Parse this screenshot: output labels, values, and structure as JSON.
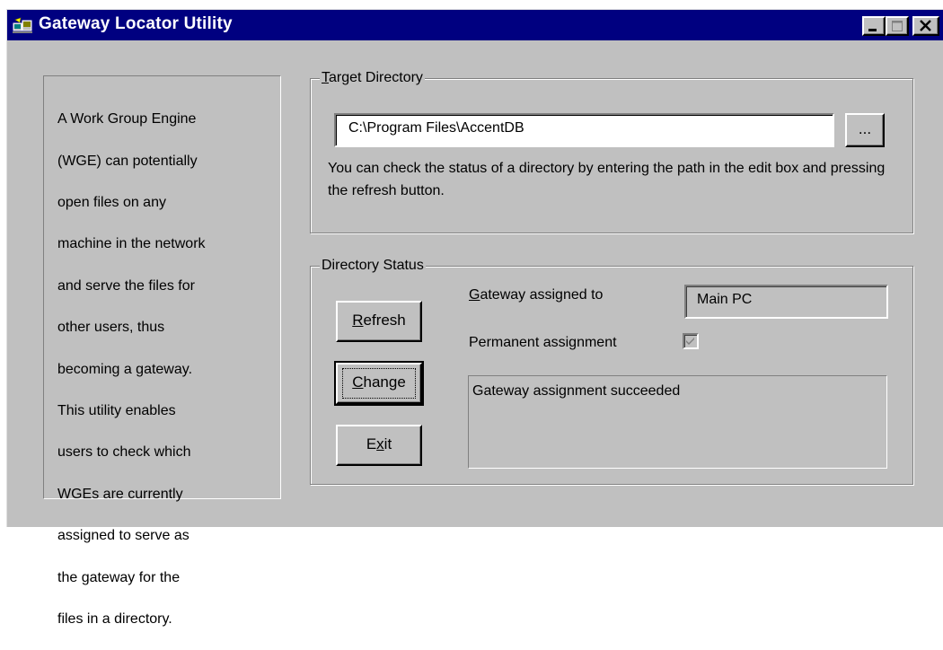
{
  "window": {
    "title": "Gateway Locator Utility",
    "controls": [
      "minimize-icon",
      "maximize-icon",
      "close-icon"
    ]
  },
  "description": {
    "lines": [
      "A Work Group Engine",
      "(WGE) can potentially",
      "open files on any",
      "machine in the network",
      "and serve the files for",
      "other users, thus",
      "becoming a gateway.",
      "This utility enables",
      "users to check which",
      "WGEs are currently",
      "assigned to serve as",
      "the gateway for the",
      "files in a directory."
    ]
  },
  "target_directory": {
    "group_label_accel": "T",
    "group_label_rest": "arget Directory",
    "path_value": "C:\\Program Files\\AccentDB",
    "browse_label": "...",
    "hint": "You can check the status of a directory by entering the path in the edit box and pressing the refresh button."
  },
  "directory_status": {
    "group_label": "Directory Status",
    "gateway_label_accel": "G",
    "gateway_label_rest": "ateway assigned to",
    "gateway_value": "Main PC",
    "permanent_label": "Permanent assignment",
    "permanent_checked": true,
    "status_message": "Gateway assignment succeeded"
  },
  "buttons": {
    "refresh_accel": "R",
    "refresh_rest": "efresh",
    "change_accel": "C",
    "change_rest": "hange",
    "exit_pre": "E",
    "exit_accel": "x",
    "exit_rest": "it"
  },
  "colors": {
    "titlebar": "#000080",
    "face": "#c0c0c0",
    "edit_bg": "#ffffff"
  }
}
